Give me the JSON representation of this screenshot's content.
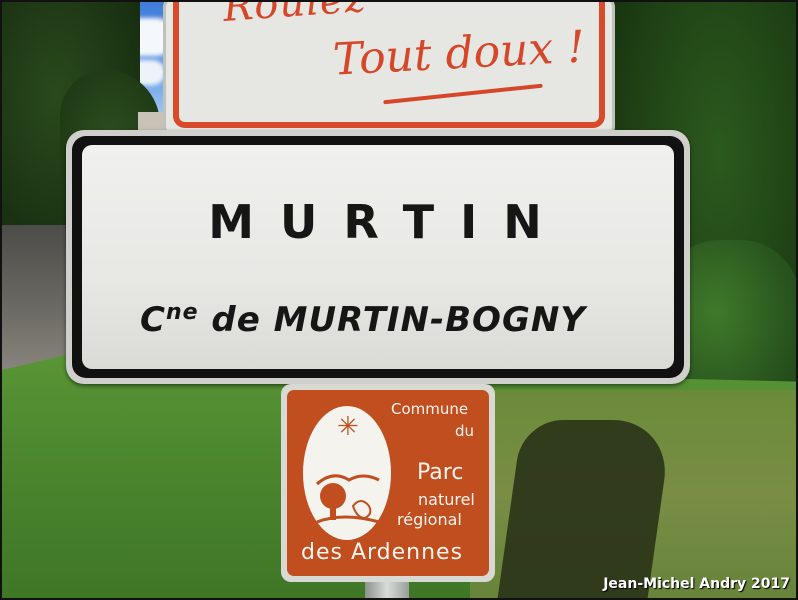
{
  "top_sign": {
    "line1": "Roulez",
    "line2": "Tout doux !"
  },
  "town_sign": {
    "name": "MURTIN",
    "sub_prefix": "C",
    "sub_sup": "ne",
    "sub_rest": " de MURTIN-BOGNY"
  },
  "park_sign": {
    "line1": "Commune",
    "line2": "du",
    "line3": "Parc",
    "line4": "naturel",
    "line5": "régional",
    "line6": "des Ardennes",
    "emblem_icon": "star-icon"
  },
  "credit": "Jean-Michel Andry 2017",
  "colors": {
    "park_brown": "#c14e1f",
    "top_sign_red": "#d6472a"
  }
}
